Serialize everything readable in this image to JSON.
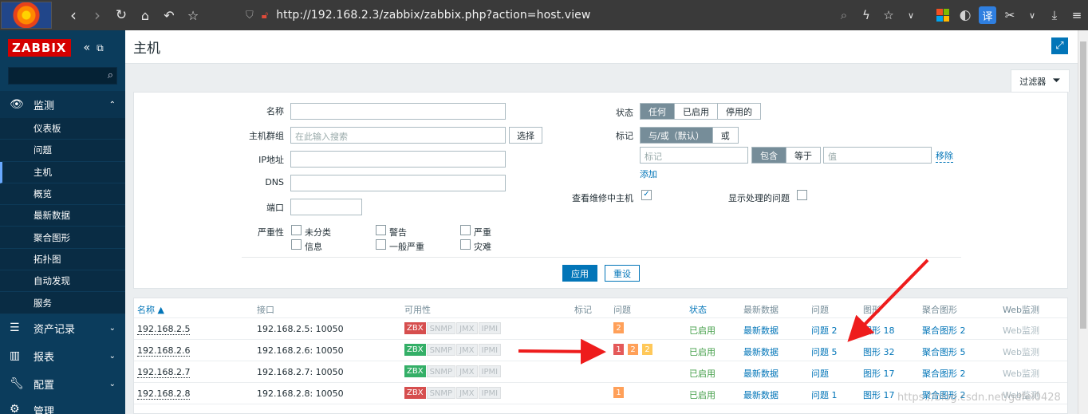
{
  "browser": {
    "url": "http://192.168.2.3/zabbix/zabbix.php?action=host.view",
    "translate_label": "译"
  },
  "sidebar": {
    "brand": "ZABBIX",
    "monitoring": "监测",
    "items": [
      {
        "label": "仪表板"
      },
      {
        "label": "问题"
      },
      {
        "label": "主机"
      },
      {
        "label": "概览"
      },
      {
        "label": "最新数据"
      },
      {
        "label": "聚合图形"
      },
      {
        "label": "拓扑图"
      },
      {
        "label": "自动发现"
      },
      {
        "label": "服务"
      }
    ],
    "inventory": "资产记录",
    "reports": "报表",
    "configuration": "配置",
    "admin": "管理"
  },
  "page": {
    "title": "主机"
  },
  "filter": {
    "tab_label": "过滤器",
    "name_label": "名称",
    "hostgroup_label": "主机群组",
    "hostgroup_placeholder": "在此输入搜索",
    "select_button": "选择",
    "ip_label": "IP地址",
    "dns_label": "DNS",
    "port_label": "端口",
    "severity_label": "严重性",
    "severities": [
      "未分类",
      "警告",
      "严重",
      "信息",
      "一般严重",
      "灾难"
    ],
    "status_label": "状态",
    "status_options": [
      "任何",
      "已启用",
      "停用的"
    ],
    "tags_label": "标记",
    "tag_ops": [
      "与/或（默认）",
      "或"
    ],
    "tag_placeholder": "标记",
    "tag_cmp": [
      "包含",
      "等于"
    ],
    "value_placeholder": "值",
    "remove_link": "移除",
    "add_link": "添加",
    "maint_label": "查看维修中主机",
    "suppressed_label": "显示处理的问题",
    "apply_button": "应用",
    "reset_button": "重设"
  },
  "table": {
    "headers": [
      "名称 ▲",
      "接口",
      "可用性",
      "标记",
      "问题",
      "状态",
      "最新数据",
      "问题",
      "图形",
      "聚合图形",
      "Web监测"
    ],
    "avail_tags": [
      "ZBX",
      "SNMP",
      "JMX",
      "IPMI"
    ],
    "rows": [
      {
        "name": "192.168.2.5",
        "iface": "192.168.2.5: 10050",
        "zbx": "red",
        "sev": [
          {
            "v": "2",
            "c": "avg"
          }
        ],
        "status": "已启用",
        "latest": "最新数据",
        "problems": "问题 2",
        "graphs": "图形 18",
        "screens": "聚合图形 2",
        "web": "Web监测"
      },
      {
        "name": "192.168.2.6",
        "iface": "192.168.2.6: 10050",
        "zbx": "green",
        "sev": [
          {
            "v": "1",
            "c": "dis"
          },
          {
            "v": "2",
            "c": "avg"
          },
          {
            "v": "2",
            "c": "wrn"
          }
        ],
        "status": "已启用",
        "latest": "最新数据",
        "problems": "问题 5",
        "graphs": "图形 32",
        "screens": "聚合图形 5",
        "web": "Web监测"
      },
      {
        "name": "192.168.2.7",
        "iface": "192.168.2.7: 10050",
        "zbx": "green",
        "sev": [],
        "status": "已启用",
        "latest": "最新数据",
        "problems": "问题",
        "graphs": "图形 17",
        "screens": "聚合图形 2",
        "web": "Web监测"
      },
      {
        "name": "192.168.2.8",
        "iface": "192.168.2.8: 10050",
        "zbx": "red",
        "sev": [
          {
            "v": "1",
            "c": "avg"
          }
        ],
        "status": "已启用",
        "latest": "最新数据",
        "problems": "问题 1",
        "graphs": "图形 17",
        "screens": "聚合图形 2",
        "web": "Web监测"
      }
    ]
  },
  "watermark": "https://blog.csdn.net/gdfei0428"
}
